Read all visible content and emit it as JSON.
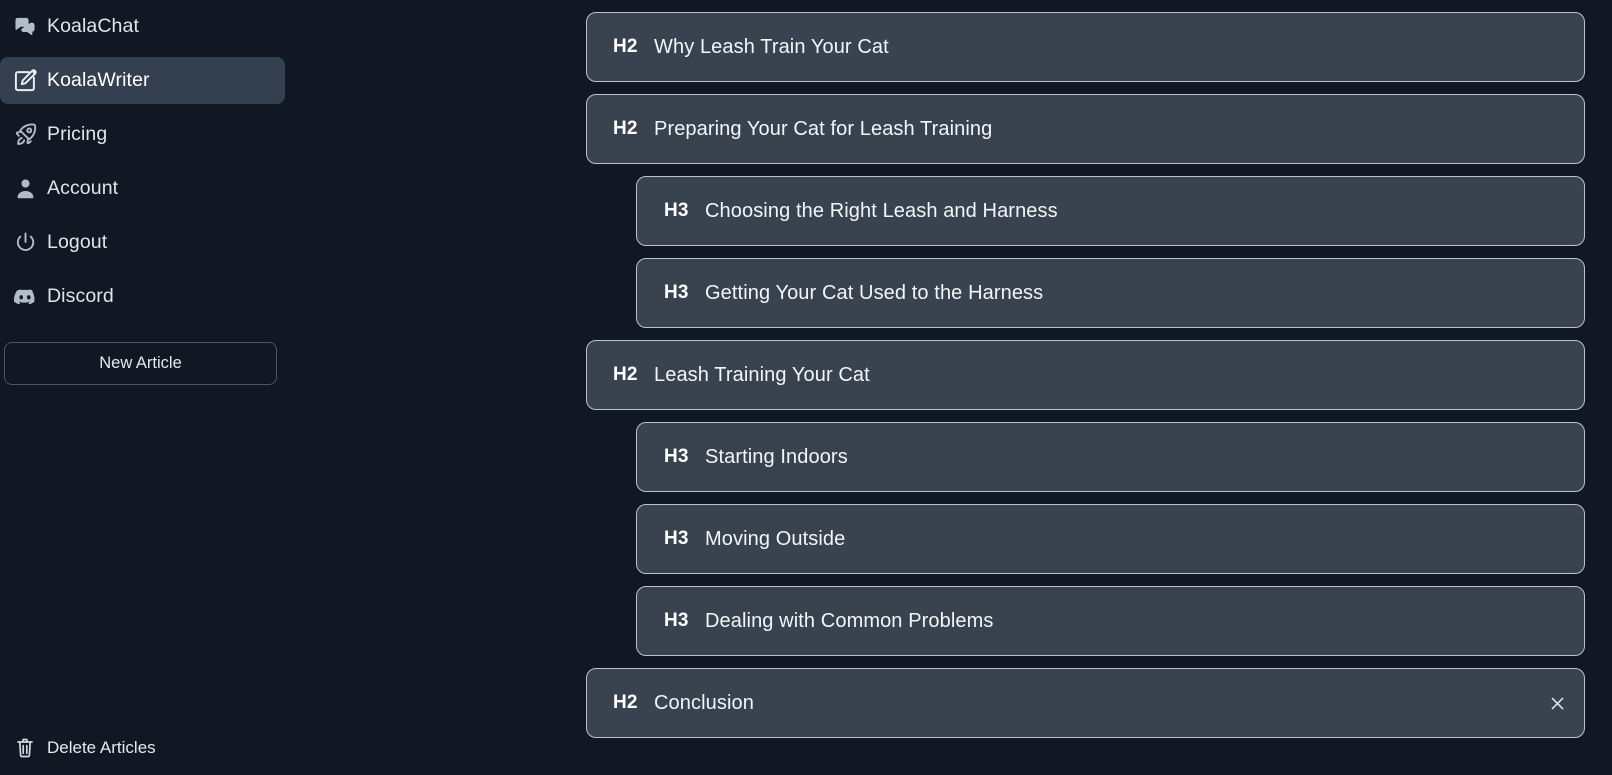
{
  "colors": {
    "background": "#111823",
    "sidebar_bg": "#111823",
    "sidebar_active_bg": "#343f4f",
    "card_bg": "#39424f",
    "card_border": "#b9c2cf",
    "text_primary": "#f2f5f9",
    "text_secondary": "#dfe5ed",
    "icon": "#b3bcc9"
  },
  "sidebar": {
    "items": [
      {
        "label": "KoalaChat",
        "icon": "chat-bubbles-icon",
        "active": false
      },
      {
        "label": "KoalaWriter",
        "icon": "pencil-square-icon",
        "active": true
      },
      {
        "label": "Pricing",
        "icon": "rocket-icon",
        "active": false
      },
      {
        "label": "Account",
        "icon": "user-icon",
        "active": false
      },
      {
        "label": "Logout",
        "icon": "power-icon",
        "active": false
      },
      {
        "label": "Discord",
        "icon": "discord-icon",
        "active": false
      }
    ],
    "new_article_label": "New Article",
    "delete_articles": {
      "label": "Delete Articles",
      "icon": "trash-icon"
    }
  },
  "outline": {
    "close_icon": "close-icon",
    "headings": [
      {
        "tag": "H2",
        "level": 2,
        "text": "Why Leash Train Your Cat",
        "closable": false
      },
      {
        "tag": "H2",
        "level": 2,
        "text": "Preparing Your Cat for Leash Training",
        "closable": false
      },
      {
        "tag": "H3",
        "level": 3,
        "text": "Choosing the Right Leash and Harness",
        "closable": false
      },
      {
        "tag": "H3",
        "level": 3,
        "text": "Getting Your Cat Used to the Harness",
        "closable": false
      },
      {
        "tag": "H2",
        "level": 2,
        "text": "Leash Training Your Cat",
        "closable": false
      },
      {
        "tag": "H3",
        "level": 3,
        "text": "Starting Indoors",
        "closable": false
      },
      {
        "tag": "H3",
        "level": 3,
        "text": "Moving Outside",
        "closable": false
      },
      {
        "tag": "H3",
        "level": 3,
        "text": "Dealing with Common Problems",
        "closable": false
      },
      {
        "tag": "H2",
        "level": 2,
        "text": "Conclusion",
        "closable": true
      }
    ]
  }
}
